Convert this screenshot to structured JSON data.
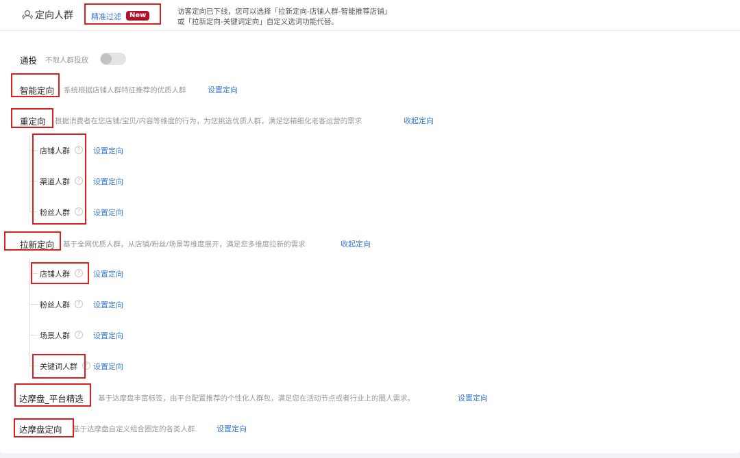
{
  "header": {
    "title": "定向人群",
    "filter_link": "精准过滤",
    "new_badge": "New",
    "notice_line1": "访客定向已下线，您可以选择「拉新定向-店铺人群-智能推荐店铺」",
    "notice_line2": "或「拉新定向-关键词定向」自定义选词功能代替。"
  },
  "sections": {
    "tongtou": {
      "label": "通投",
      "desc": "不限人群投放",
      "toggle_on": false
    },
    "smart": {
      "label": "智能定向",
      "desc": "系统根据店铺人群特征推荐的优质人群",
      "action": "设置定向"
    },
    "retarget": {
      "label": "重定向",
      "desc": "根据消费者在您店铺/宝贝/内容等维度的行为，为您挑选优质人群，满足您精细化老客运营的需求",
      "action": "收起定向",
      "items": [
        {
          "label": "店铺人群",
          "action": "设置定向"
        },
        {
          "label": "渠道人群",
          "action": "设置定向"
        },
        {
          "label": "粉丝人群",
          "action": "设置定向"
        }
      ]
    },
    "acquire": {
      "label": "拉新定向",
      "desc": "基于全网优质人群，从店铺/粉丝/场景等维度展开，满足您多维度拉新的需求",
      "action": "收起定向",
      "items": [
        {
          "label": "店铺人群",
          "action": "设置定向"
        },
        {
          "label": "粉丝人群",
          "action": "设置定向"
        },
        {
          "label": "场景人群",
          "action": "设置定向"
        },
        {
          "label": "关键词人群",
          "action": "设置定向"
        }
      ]
    },
    "damopan_platform": {
      "label": "达摩盘_平台精选",
      "desc": "基于达摩盘丰富标签，由平台配置推荐的个性化人群包，满足您在活动节点或者行业上的圈人需求。",
      "action": "设置定向"
    },
    "damopan": {
      "label": "达摩盘定向",
      "desc": "基于达摩盘自定义组合圈定的各类人群",
      "action": "设置定向"
    }
  },
  "help_icon": "?",
  "colors": {
    "link": "#3a7bd5",
    "highlight_box": "#e01e1e",
    "badge": "#b3112a"
  }
}
